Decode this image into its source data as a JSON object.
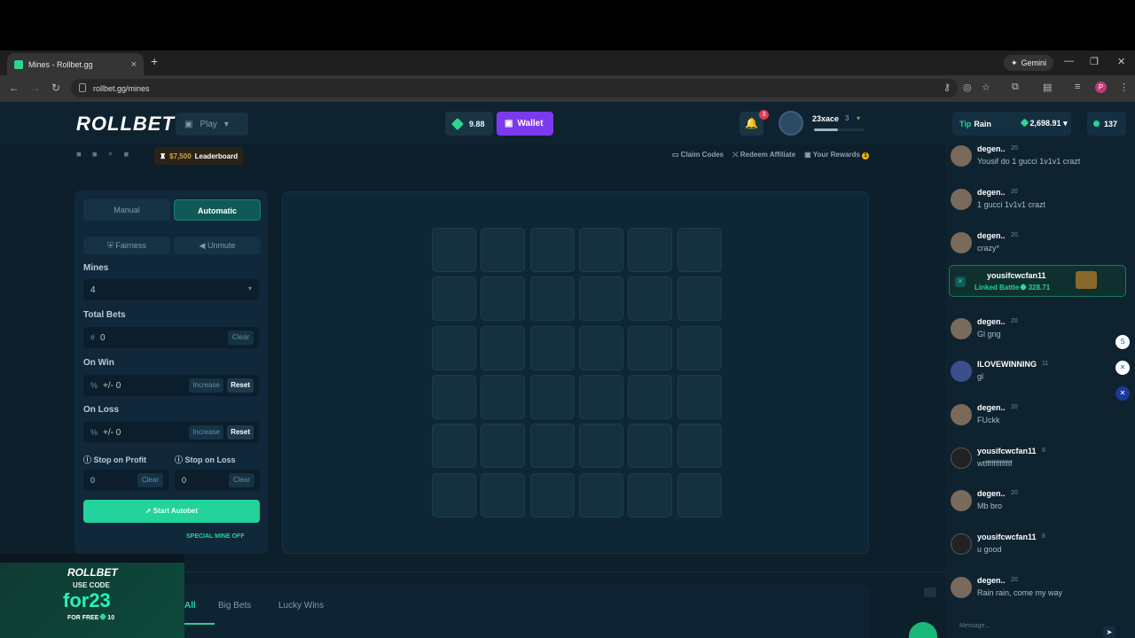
{
  "browser": {
    "tab_title": "Mines - Rollbet.gg",
    "tab_close": "×",
    "new_tab": "+",
    "gemini_label": "Gemini",
    "url": "rollbet.gg/mines",
    "profile_initial": "P"
  },
  "header": {
    "logo": "ROLLBET",
    "play_label": "Play",
    "balance": "9.88",
    "wallet_label": "Wallet",
    "notif_count": "3",
    "username": "23xace",
    "user_level": "3",
    "xp_progress": 0.48
  },
  "subnav": {
    "leaderboard_amount": "$7,500",
    "leaderboard_label": "Leaderboard",
    "claim_codes": "Claim Codes",
    "redeem_affiliate": "Redeem Affiliate",
    "your_rewards": "Your Rewards",
    "rewards_badge": "1"
  },
  "panel": {
    "manual_tab": "Manual",
    "automatic_tab": "Automatic",
    "fairness_label": "Fairness",
    "unmute_label": "Unmute",
    "mines_label": "Mines",
    "mines_value": "4",
    "total_bets_label": "Total Bets",
    "total_bets_prefix": "#",
    "total_bets_value": "0",
    "clear_label": "Clear",
    "on_win_label": "On Win",
    "on_win_prefix": "%",
    "on_win_value": "+/- 0",
    "increase_label": "Increase",
    "reset_label": "Reset",
    "on_loss_label": "On Loss",
    "on_loss_prefix": "%",
    "on_loss_value": "+/- 0",
    "stop_profit_label": "Stop on Profit",
    "stop_loss_label": "Stop on Loss",
    "stop_profit_value": "0",
    "stop_loss_value": "0",
    "start_label": "Start Autobet",
    "special_label": "SPECIAL MINE OFF"
  },
  "board": {
    "rows": 6,
    "cols": 6
  },
  "bottom_tabs": {
    "all": "All",
    "big_bets": "Big Bets",
    "lucky_wins": "Lucky Wins"
  },
  "promo": {
    "logo": "ROLLBET",
    "use_code": "USE CODE",
    "code": "for23",
    "for_free": "FOR FREE",
    "amount": "10"
  },
  "chat": {
    "tip_label": "Tip",
    "rain_label": "Rain",
    "rain_amount": "2,698.91",
    "online_count": "137",
    "messages": [
      {
        "name": "degen..",
        "level": "20",
        "text": "Yousif do 1 gucci 1v1v1 crazt"
      },
      {
        "name": "degen..",
        "level": "20",
        "text": "1 gucci 1v1v1 crazt"
      },
      {
        "name": "degen..",
        "level": "20",
        "text": "crazy*"
      },
      {
        "name": "degen..",
        "level": "20",
        "text": "Gl gng"
      },
      {
        "name": "ILOVEWINNING",
        "level": "11",
        "text": "gl"
      },
      {
        "name": "degen..",
        "level": "20",
        "text": "FUckk"
      },
      {
        "name": "yousifcwcfan11",
        "level": "8",
        "text": "wtfffffffffffff"
      },
      {
        "name": "degen..",
        "level": "20",
        "text": "Mb bro"
      },
      {
        "name": "yousifcwcfan11",
        "level": "8",
        "text": "u good"
      },
      {
        "name": "degen..",
        "level": "20",
        "text": "Rain rain, come my way"
      }
    ],
    "battle": {
      "name": "yousifcwcfan11",
      "label": "Linked Battle",
      "amount": "328.71"
    },
    "input_placeholder": "Message..."
  },
  "colors": {
    "accent_green": "#22d39b",
    "wallet_purple": "#7c3aed",
    "background": "#0d1f2b"
  }
}
